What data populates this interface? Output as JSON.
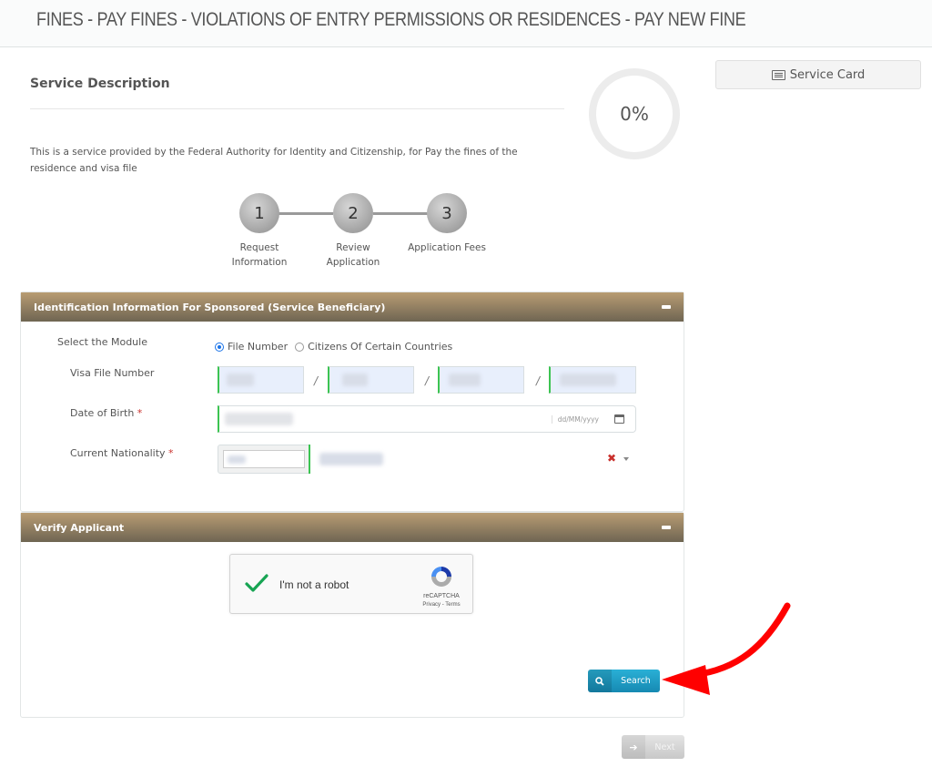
{
  "header": {
    "title": "FINES - PAY FINES - VIOLATIONS OF ENTRY PERMISSIONS OR RESIDENCES - PAY NEW FINE"
  },
  "service_description": {
    "heading": "Service Description",
    "text": "This is a service provided by the Federal Authority for Identity and Citizenship, for Pay the fines of the residence and visa file"
  },
  "progress": {
    "value_percent": 0,
    "label": "0%"
  },
  "service_card": {
    "label": "Service Card",
    "icon": "card-list-icon"
  },
  "steps": [
    {
      "number": "1",
      "label_line1": "Request",
      "label_line2": "Information"
    },
    {
      "number": "2",
      "label_line1": "Review",
      "label_line2": "Application"
    },
    {
      "number": "3",
      "label_line1": "Application Fees",
      "label_line2": ""
    }
  ],
  "identification_panel": {
    "title": "Identification Information For Sponsored (Service Beneficiary)",
    "collapse_icon": "minus-icon",
    "module": {
      "label": "Select the Module",
      "options": [
        "File Number",
        "Citizens Of Certain Countries"
      ],
      "selected": "File Number"
    },
    "visa_file_number": {
      "label": "Visa File Number",
      "separator": "/",
      "parts": [
        "",
        "",
        "",
        ""
      ]
    },
    "date_of_birth": {
      "label": "Date of Birth",
      "required_marker": "*",
      "value": "",
      "format_hint": "dd/MM/yyyy"
    },
    "current_nationality": {
      "label": "Current Nationality",
      "required_marker": "*",
      "code": "",
      "value": "",
      "clear_symbol": "✖"
    }
  },
  "verify_panel": {
    "title": "Verify Applicant",
    "collapse_icon": "minus-icon",
    "recaptcha": {
      "label": "I'm not a robot",
      "checked": true,
      "brand": "reCAPTCHA",
      "links": "Privacy - Terms"
    },
    "search_button": {
      "label": "Search",
      "icon": "search-icon"
    }
  },
  "footer": {
    "next_button": {
      "label": "Next",
      "icon": "arrow-right-icon",
      "enabled": false
    }
  },
  "colors": {
    "panel_header_top": "#b89c73",
    "panel_header_bottom": "#6f6552",
    "input_valid_border": "#3cc452",
    "search_button": "#1e9cc6",
    "required": "#c9302c",
    "annotation_arrow": "#ff0000"
  }
}
